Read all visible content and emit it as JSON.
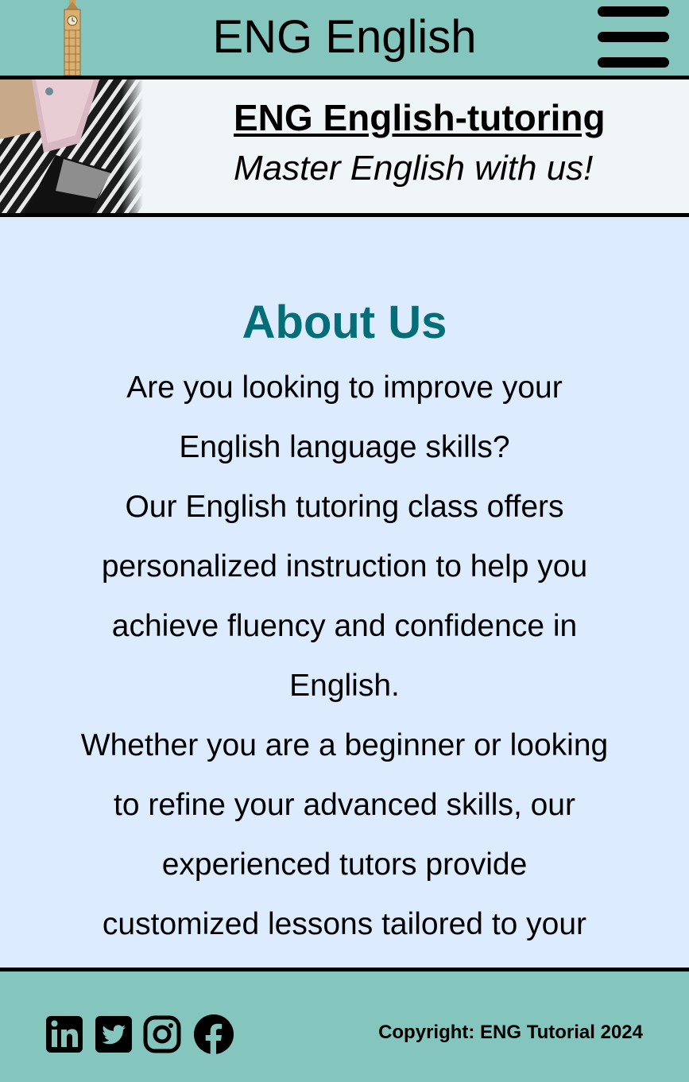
{
  "header": {
    "site_title": "ENG English",
    "logo_icon": "big-ben-icon",
    "menu_icon": "hamburger-menu-icon"
  },
  "hero": {
    "title": "ENG English-tutoring",
    "subtitle": "Master English with us!"
  },
  "about": {
    "heading": "About Us",
    "paragraph_lines": [
      "Are you looking to improve your",
      "English language skills?",
      "Our English tutoring class offers",
      "personalized instruction to help you",
      "achieve fluency and confidence in",
      "English.",
      "Whether you are a beginner or looking",
      "to refine your advanced skills, our",
      "experienced tutors provide",
      "customized lessons tailored to your"
    ]
  },
  "footer": {
    "social_icons": [
      "linkedin-icon",
      "twitter-icon",
      "instagram-icon",
      "facebook-icon"
    ],
    "copyright": "Copyright: ENG Tutorial 2024"
  },
  "colors": {
    "nav_bg": "#84c5bd",
    "page_bg": "#dcebfd",
    "heading_teal": "#036d78",
    "hero_bg": "#f0f6f8"
  }
}
